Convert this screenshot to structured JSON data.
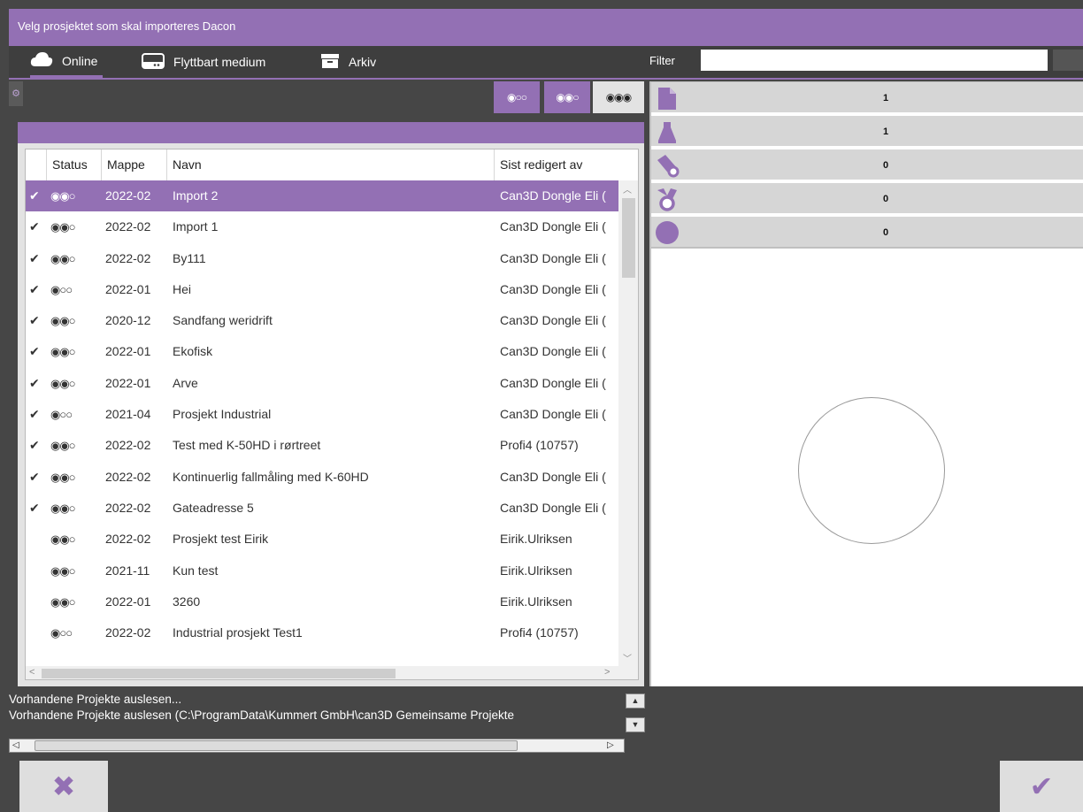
{
  "window": {
    "title": "Velg prosjektet som skal importeres Dacon"
  },
  "tabs": [
    {
      "label": "Online",
      "icon": "cloud-icon"
    },
    {
      "label": "Flyttbart medium",
      "icon": "drive-icon"
    },
    {
      "label": "Arkiv",
      "icon": "archive-icon"
    }
  ],
  "filter": {
    "label": "Filter",
    "value": ""
  },
  "view_modes": [
    {
      "label": "◉○○"
    },
    {
      "label": "◉◉○"
    },
    {
      "label": "◉◉◉"
    }
  ],
  "table": {
    "columns": [
      "Status",
      "Mappe",
      "Navn",
      "Sist redigert av"
    ],
    "rows": [
      {
        "check": "✔",
        "status": "◉◉○",
        "folder": "2022-02",
        "name": "Import 2",
        "editor": "Can3D Dongle Eli ("
      },
      {
        "check": "✔",
        "status": "◉◉○",
        "folder": "2022-02",
        "name": "Import 1",
        "editor": "Can3D Dongle Eli ("
      },
      {
        "check": "✔",
        "status": "◉◉○",
        "folder": "2022-02",
        "name": "By111",
        "editor": "Can3D Dongle Eli ("
      },
      {
        "check": "✔",
        "status": "◉○○",
        "folder": "2022-01",
        "name": "Hei",
        "editor": "Can3D Dongle Eli ("
      },
      {
        "check": "✔",
        "status": "◉◉○",
        "folder": "2020-12",
        "name": "Sandfang weridrift",
        "editor": "Can3D Dongle Eli ("
      },
      {
        "check": "✔",
        "status": "◉◉○",
        "folder": "2022-01",
        "name": "Ekofisk",
        "editor": "Can3D Dongle Eli ("
      },
      {
        "check": "✔",
        "status": "◉◉○",
        "folder": "2022-01",
        "name": "Arve",
        "editor": "Can3D Dongle Eli ("
      },
      {
        "check": "✔",
        "status": "◉○○",
        "folder": "2021-04",
        "name": "Prosjekt Industrial",
        "editor": "Can3D Dongle Eli ("
      },
      {
        "check": "✔",
        "status": "◉◉○",
        "folder": "2022-02",
        "name": "Test med K-50HD i rørtreet",
        "editor": "Profi4 (10757)"
      },
      {
        "check": "✔",
        "status": "◉◉○",
        "folder": "2022-02",
        "name": "Kontinuerlig fallmåling med K-60HD",
        "editor": "Can3D Dongle Eli ("
      },
      {
        "check": "✔",
        "status": "◉◉○",
        "folder": "2022-02",
        "name": "Gateadresse 5",
        "editor": "Can3D Dongle Eli ("
      },
      {
        "check": "",
        "status": "◉◉○",
        "folder": "2022-02",
        "name": "Prosjekt test Eirik",
        "editor": "Eirik.Ulriksen"
      },
      {
        "check": "",
        "status": "◉◉○",
        "folder": "2021-11",
        "name": "Kun test",
        "editor": "Eirik.Ulriksen"
      },
      {
        "check": "",
        "status": "◉◉○",
        "folder": "2022-01",
        "name": "3260",
        "editor": "Eirik.Ulriksen"
      },
      {
        "check": "",
        "status": "◉○○",
        "folder": "2022-02",
        "name": "Industrial prosjekt Test1",
        "editor": "Profi4 (10757)"
      }
    ],
    "selected_index": 0
  },
  "log": {
    "lines": [
      "Vorhandene Projekte auslesen...",
      "Vorhandene Projekte auslesen (C:\\ProgramData\\Kummert GmbH\\can3D Gemeinsame Projekte"
    ]
  },
  "stats": [
    {
      "icon": "document-icon",
      "value": "1"
    },
    {
      "icon": "manhole-icon",
      "value": "1"
    },
    {
      "icon": "pipe-icon",
      "value": "0"
    },
    {
      "icon": "pipe-junction-icon",
      "value": "0"
    },
    {
      "icon": "circle-icon",
      "value": "0"
    }
  ],
  "buttons": {
    "cancel": "✖",
    "confirm": "✔"
  },
  "colors": {
    "accent": "#9370b4",
    "dark_bg": "#464646",
    "panel_light": "#e3e3e3"
  }
}
